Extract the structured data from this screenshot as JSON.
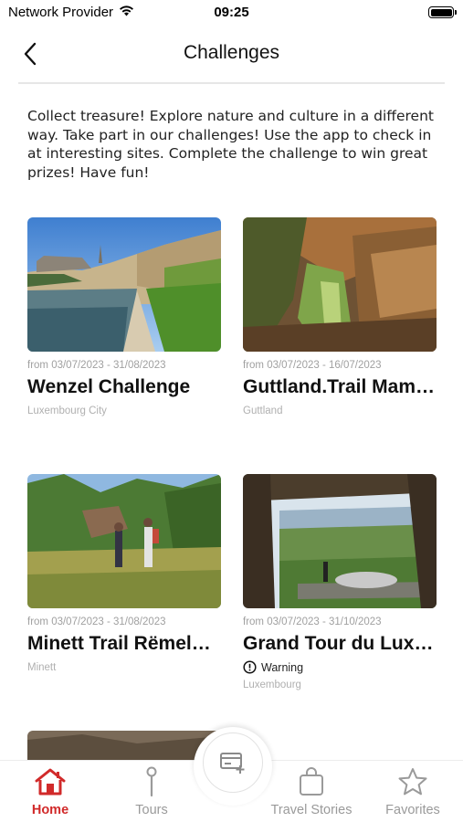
{
  "status_bar": {
    "carrier": "Network Provider",
    "time": "09:25"
  },
  "nav": {
    "title": "Challenges"
  },
  "intro": "Collect treasure! Explore nature and culture in a different way. Take part in our challenges! Use the app to check in at interesting sites. Complete the challenge to win great prizes! Have fun!",
  "cards": [
    {
      "date": "from 03/07/2023 - 31/08/2023",
      "title": "Wenzel Challenge",
      "location": "Luxembourg City"
    },
    {
      "date": "from 03/07/2023 - 16/07/2023",
      "title": "Guttland.Trail Mam…",
      "location": "Guttland"
    },
    {
      "date": "from 03/07/2023 - 31/08/2023",
      "title": "Minett Trail Rëmele…",
      "location": "Minett"
    },
    {
      "date": "from 03/07/2023 - 31/10/2023",
      "title": "Grand Tour du Luxe…",
      "warning": "Warning",
      "location": "Luxembourg"
    }
  ],
  "tabs": [
    {
      "label": "Home",
      "icon": "home-icon",
      "active": true
    },
    {
      "label": "Tours",
      "icon": "pin-icon",
      "active": false
    },
    {
      "label": "Travel Stories",
      "icon": "bag-icon",
      "active": false
    },
    {
      "label": "Favorites",
      "icon": "star-icon",
      "active": false
    }
  ],
  "colors": {
    "accent": "#d12a2a",
    "inactive": "#9a9a9a"
  }
}
